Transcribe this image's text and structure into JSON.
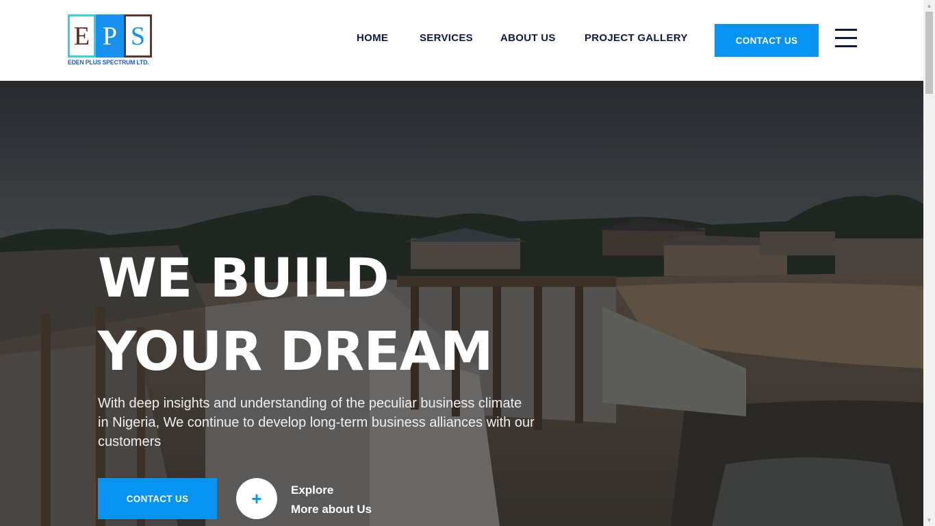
{
  "header": {
    "logo": {
      "letters": [
        "E",
        "P",
        "S"
      ],
      "subtitle": "EDEN PLUS SPECTRUM LTD."
    },
    "nav": [
      "HOME",
      "SERVICES",
      "ABOUT US",
      "PROJECT GALLERY"
    ],
    "cta_label": "CONTACT US"
  },
  "hero": {
    "title_line1": "WE BUILD",
    "title_line2": "YOUR DREAM",
    "text": "With deep insights and understanding of the peculiar business climate in Nigeria, We continue to develop long-term business alliances with our customers",
    "cta_label": "CONTACT US",
    "explore_icon": "+",
    "explore_line1": "Explore",
    "explore_line2": "More about Us"
  },
  "colors": {
    "accent": "#0793f2",
    "nav_text": "#0e1a3d",
    "logo_cyan": "#2fd3e6",
    "logo_brown": "#6b2f25"
  },
  "icons": {
    "menu": "hamburger-menu-icon",
    "explore": "plus-icon"
  }
}
